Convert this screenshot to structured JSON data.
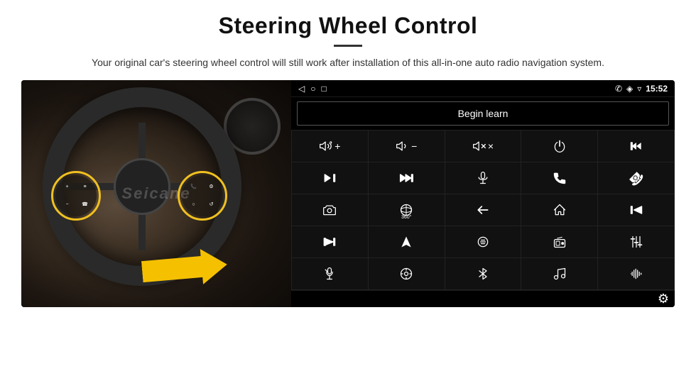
{
  "header": {
    "title": "Steering Wheel Control",
    "subtitle": "Your original car's steering wheel control will still work after installation of this all-in-one auto radio navigation system."
  },
  "status_bar": {
    "back_icon": "◁",
    "home_icon": "○",
    "recents_icon": "□",
    "battery_icon": "▪▪",
    "phone_icon": "✆",
    "location_icon": "◈",
    "wifi_icon": "▿",
    "time": "15:52"
  },
  "begin_learn": {
    "label": "Begin learn"
  },
  "controls": [
    {
      "id": "vol-up",
      "icon_type": "vol-up"
    },
    {
      "id": "vol-down",
      "icon_type": "vol-down"
    },
    {
      "id": "mute",
      "icon_type": "mute"
    },
    {
      "id": "power",
      "icon_type": "power"
    },
    {
      "id": "prev-track",
      "icon_type": "prev-track"
    },
    {
      "id": "skip-fwd",
      "icon_type": "skip-fwd"
    },
    {
      "id": "fast-fwd",
      "icon_type": "fast-fwd"
    },
    {
      "id": "mic",
      "icon_type": "mic"
    },
    {
      "id": "phone",
      "icon_type": "phone"
    },
    {
      "id": "hang-up",
      "icon_type": "hang-up"
    },
    {
      "id": "camera",
      "icon_type": "camera"
    },
    {
      "id": "360-view",
      "icon_type": "360-view"
    },
    {
      "id": "back",
      "icon_type": "back"
    },
    {
      "id": "home",
      "icon_type": "home"
    },
    {
      "id": "skip-prev",
      "icon_type": "skip-prev"
    },
    {
      "id": "skip-end",
      "icon_type": "skip-end"
    },
    {
      "id": "nav",
      "icon_type": "nav"
    },
    {
      "id": "equalizer",
      "icon_type": "equalizer"
    },
    {
      "id": "radio",
      "icon_type": "radio"
    },
    {
      "id": "sliders",
      "icon_type": "sliders"
    },
    {
      "id": "mic2",
      "icon_type": "mic2"
    },
    {
      "id": "settings-circle",
      "icon_type": "settings-circle"
    },
    {
      "id": "bluetooth",
      "icon_type": "bluetooth"
    },
    {
      "id": "music",
      "icon_type": "music"
    },
    {
      "id": "equalizer2",
      "icon_type": "equalizer2"
    }
  ],
  "gear_icon": "⚙"
}
